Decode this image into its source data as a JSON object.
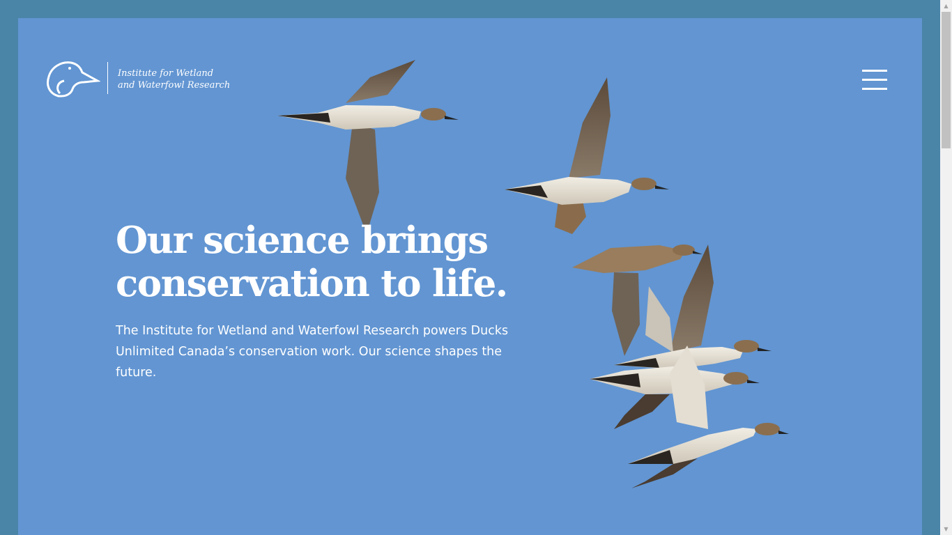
{
  "header": {
    "logo_line1": "Institute for Wetland",
    "logo_line2": "and Waterfowl Research",
    "menu_icon": "hamburger-menu-icon"
  },
  "hero": {
    "headline_line1": "Our science brings",
    "headline_line2": "conservation to life.",
    "description": "The Institute for Wetland and Waterfowl Research powers Ducks Unlimited Canada’s conservation work. Our science shapes the future.",
    "image_subject": "flock of northern pintail ducks in flight"
  },
  "colors": {
    "page_border": "#4a84a7",
    "hero_background": "#6295d2",
    "text": "#ffffff"
  }
}
